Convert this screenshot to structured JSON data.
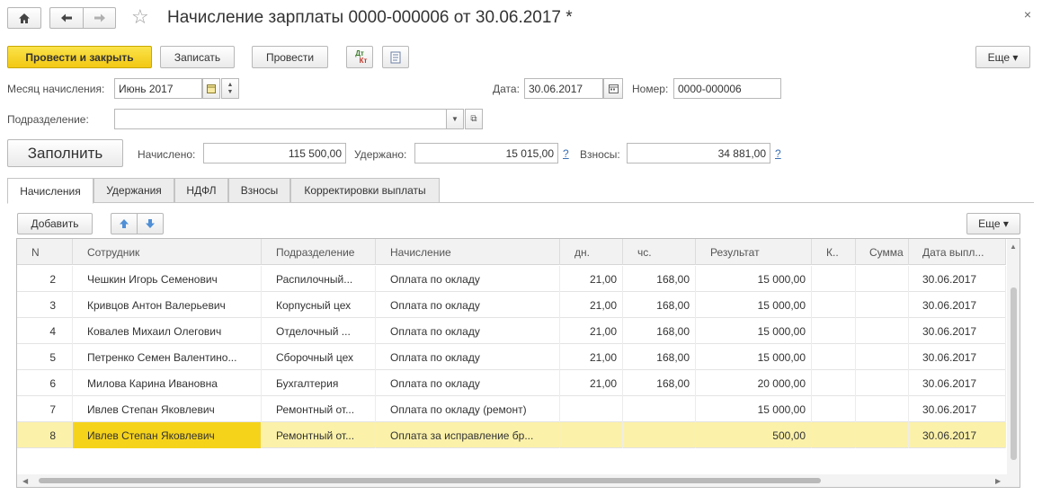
{
  "header": {
    "title": "Начисление зарплаты 0000-000006 от 30.06.2017 *",
    "home_icon": "home-icon",
    "back_icon": "arrow-left-icon",
    "forward_icon": "arrow-right-icon",
    "favorite_icon": "star-icon",
    "close_glyph": "×"
  },
  "toolbar": {
    "post_and_close": "Провести и закрыть",
    "save": "Записать",
    "post": "Провести",
    "dtkt_top": "Дт",
    "dtkt_bottom": "Кт",
    "more": "Еще ▾"
  },
  "form": {
    "month_label": "Месяц начисления:",
    "month_value": "Июнь 2017",
    "date_label": "Дата:",
    "date_value": "30.06.2017",
    "number_label": "Номер:",
    "number_value": "0000-000006",
    "department_label": "Подразделение:",
    "department_value": "",
    "fill_button": "Заполнить",
    "accrued_label": "Начислено:",
    "accrued_value": "115 500,00",
    "withheld_label": "Удержано:",
    "withheld_value": "15 015,00",
    "contributions_label": "Взносы:",
    "contributions_value": "34 881,00",
    "help_glyph": "?"
  },
  "tabs": [
    "Начисления",
    "Удержания",
    "НДФЛ",
    "Взносы",
    "Корректировки выплаты"
  ],
  "table_toolbar": {
    "add": "Добавить",
    "more": "Еще ▾"
  },
  "table": {
    "columns": [
      "N",
      "Сотрудник",
      "Подразделение",
      "Начисление",
      "дн.",
      "чс.",
      "Результат",
      "К..",
      "Сумма",
      "Дата выпл..."
    ],
    "rows": [
      [
        "2",
        "Чешкин Игорь Семенович",
        "Распилочный...",
        "Оплата по окладу",
        "21,00",
        "168,00",
        "15 000,00",
        "",
        "",
        "30.06.2017"
      ],
      [
        "3",
        "Кривцов Антон Валерьевич",
        "Корпусный цех",
        "Оплата по окладу",
        "21,00",
        "168,00",
        "15 000,00",
        "",
        "",
        "30.06.2017"
      ],
      [
        "4",
        "Ковалев Михаил Олегович",
        "Отделочный ...",
        "Оплата по окладу",
        "21,00",
        "168,00",
        "15 000,00",
        "",
        "",
        "30.06.2017"
      ],
      [
        "5",
        "Петренко Семен Валентино...",
        "Сборочный цех",
        "Оплата по окладу",
        "21,00",
        "168,00",
        "15 000,00",
        "",
        "",
        "30.06.2017"
      ],
      [
        "6",
        "Милова Карина Ивановна",
        "Бухгалтерия",
        "Оплата по окладу",
        "21,00",
        "168,00",
        "20 000,00",
        "",
        "",
        "30.06.2017"
      ],
      [
        "7",
        "Ивлев Степан Яковлевич",
        "Ремонтный от...",
        "Оплата по окладу (ремонт)",
        "",
        "",
        "15 000,00",
        "",
        "",
        "30.06.2017"
      ],
      [
        "8",
        "Ивлев Степан Яковлевич",
        "Ремонтный от...",
        "Оплата за исправление бр...",
        "",
        "",
        "500,00",
        "",
        "",
        "30.06.2017"
      ]
    ],
    "selected_row_index": 6
  },
  "colors": {
    "primary_button": "#f2c813",
    "selected_row": "#fbf1a9",
    "selected_cell": "#f6d31b",
    "link": "#3a6fb5"
  }
}
